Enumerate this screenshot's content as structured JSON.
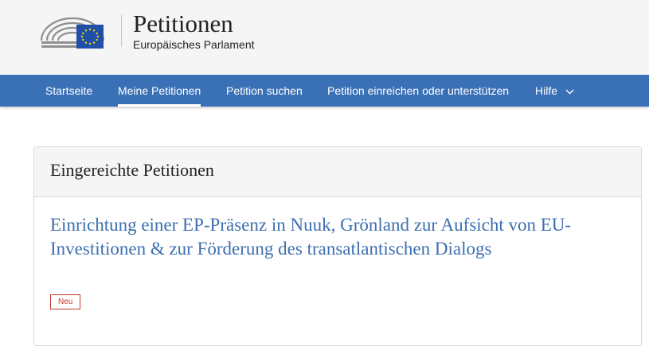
{
  "header": {
    "title": "Petitionen",
    "subtitle": "Europäisches Parlament"
  },
  "nav": {
    "items": [
      {
        "label": "Startseite"
      },
      {
        "label": "Meine Petitionen",
        "active": true
      },
      {
        "label": "Petition suchen"
      },
      {
        "label": "Petition einreichen oder unterstützen"
      },
      {
        "label": "Hilfe"
      }
    ]
  },
  "panel": {
    "title": "Eingereichte Petitionen",
    "petition": {
      "title": "Einrichtung einer EP-Präsenz in Nuuk, Grönland zur Aufsicht von EU-Investitionen & zur Förderung des transatlantischen Dialogs",
      "badge": "Neu"
    }
  },
  "colors": {
    "nav_bg": "#3a70b5",
    "link": "#3d6fb0",
    "badge": "#c0392b",
    "eu_blue": "#1f4fa6",
    "eu_star": "#ffd617"
  }
}
